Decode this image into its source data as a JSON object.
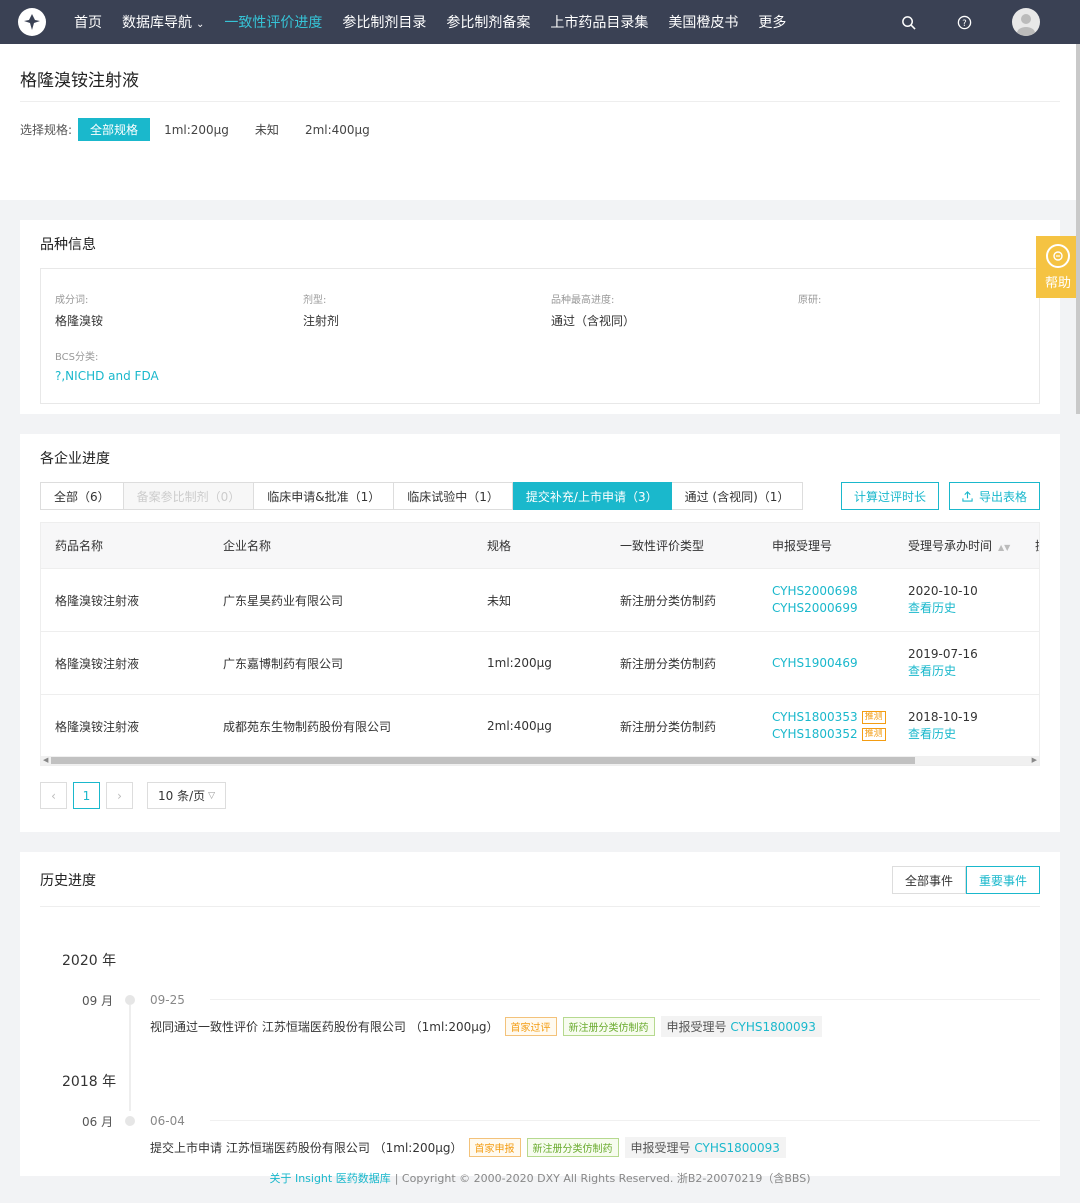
{
  "nav": {
    "items": [
      {
        "label": "首页",
        "active": false,
        "caret": false
      },
      {
        "label": "数据库导航",
        "active": false,
        "caret": true
      },
      {
        "label": "一致性评价进度",
        "active": true,
        "caret": false
      },
      {
        "label": "参比制剂目录",
        "active": false,
        "caret": false
      },
      {
        "label": "参比制剂备案",
        "active": false,
        "caret": false
      },
      {
        "label": "上市药品目录集",
        "active": false,
        "caret": false
      },
      {
        "label": "美国橙皮书",
        "active": false,
        "caret": false
      },
      {
        "label": "更多",
        "active": false,
        "caret": false
      }
    ]
  },
  "page": {
    "title": "格隆溴铵注射液",
    "spec_label": "选择规格:",
    "specs": [
      "全部规格",
      "1ml:200μg",
      "未知",
      "2ml:400μg"
    ],
    "selected_spec": 0
  },
  "variety": {
    "title": "品种信息",
    "fields": [
      {
        "label": "成分词:",
        "value": "格隆溴铵"
      },
      {
        "label": "剂型:",
        "value": "注射剂"
      },
      {
        "label": "品种最高进度:",
        "value": "通过（含视同）"
      },
      {
        "label": "原研:",
        "value": ""
      },
      {
        "label": "BCS分类:",
        "value": "?,NICHD and FDA"
      }
    ]
  },
  "progress": {
    "title": "各企业进度",
    "tabs": [
      {
        "label": "全部（6）",
        "state": "normal"
      },
      {
        "label": "备案参比制剂（0）",
        "state": "disabled"
      },
      {
        "label": "临床申请&批准（1）",
        "state": "normal"
      },
      {
        "label": "临床试验中（1）",
        "state": "normal"
      },
      {
        "label": "提交补充/上市申请（3）",
        "state": "active"
      },
      {
        "label": "通过 (含视同)（1）",
        "state": "normal"
      }
    ],
    "calc_button": "计算过评时长",
    "export_button": "导出表格",
    "columns": [
      "药品名称",
      "企业名称",
      "规格",
      "一致性评价类型",
      "申报受理号",
      "受理号承办时间",
      "操"
    ],
    "rows": [
      {
        "drug": "格隆溴铵注射液",
        "company": "广东星昊药业有限公司",
        "spec": "未知",
        "type": "新注册分类仿制药",
        "nos": [
          "CYHS2000698",
          "CYHS2000699"
        ],
        "tags": [
          "",
          ""
        ],
        "date": "2020-10-10",
        "history": "查看历史"
      },
      {
        "drug": "格隆溴铵注射液",
        "company": "广东嘉博制药有限公司",
        "spec": "1ml:200μg",
        "type": "新注册分类仿制药",
        "nos": [
          "CYHS1900469"
        ],
        "tags": [
          ""
        ],
        "date": "2019-07-16",
        "history": "查看历史"
      },
      {
        "drug": "格隆溴铵注射液",
        "company": "成都苑东生物制药股份有限公司",
        "spec": "2ml:400μg",
        "type": "新注册分类仿制药",
        "nos": [
          "CYHS1800353",
          "CYHS1800352"
        ],
        "tags": [
          "推测",
          "推测"
        ],
        "date": "2018-10-19",
        "history": "查看历史"
      }
    ],
    "pager": {
      "current": "1",
      "page_size": "10 条/页"
    }
  },
  "history": {
    "title": "历史进度",
    "toggle": [
      "全部事件",
      "重要事件"
    ],
    "toggle_selected": 1,
    "groups": [
      {
        "year": "2020 年",
        "month": "09 月",
        "date": "09-25",
        "event": "视同通过一致性评价 江苏恒瑞医药股份有限公司 （1ml:200μg）",
        "tags": [
          {
            "text": "首家过评",
            "color": "orange"
          },
          {
            "text": "新注册分类仿制药",
            "color": "green"
          }
        ],
        "ref_label": "申报受理号",
        "ref_no": "CYHS1800093"
      },
      {
        "year": "2018 年",
        "month": "06 月",
        "date": "06-04",
        "event": "提交上市申请 江苏恒瑞医药股份有限公司 （1ml:200μg）",
        "tags": [
          {
            "text": "首家申报",
            "color": "orange"
          },
          {
            "text": "新注册分类仿制药",
            "color": "green"
          }
        ],
        "ref_label": "申报受理号",
        "ref_no": "CYHS1800093"
      }
    ]
  },
  "footer": {
    "link": "关于 Insight 医药数据库",
    "text": "| Copyright © 2000-2020 DXY All Rights Reserved. 浙B2-20070219（含BBS)"
  },
  "help": {
    "label": "帮助"
  },
  "colors": {
    "accent": "#1ab8cc",
    "nav_bg": "#3a4154",
    "help": "#f5c342"
  }
}
